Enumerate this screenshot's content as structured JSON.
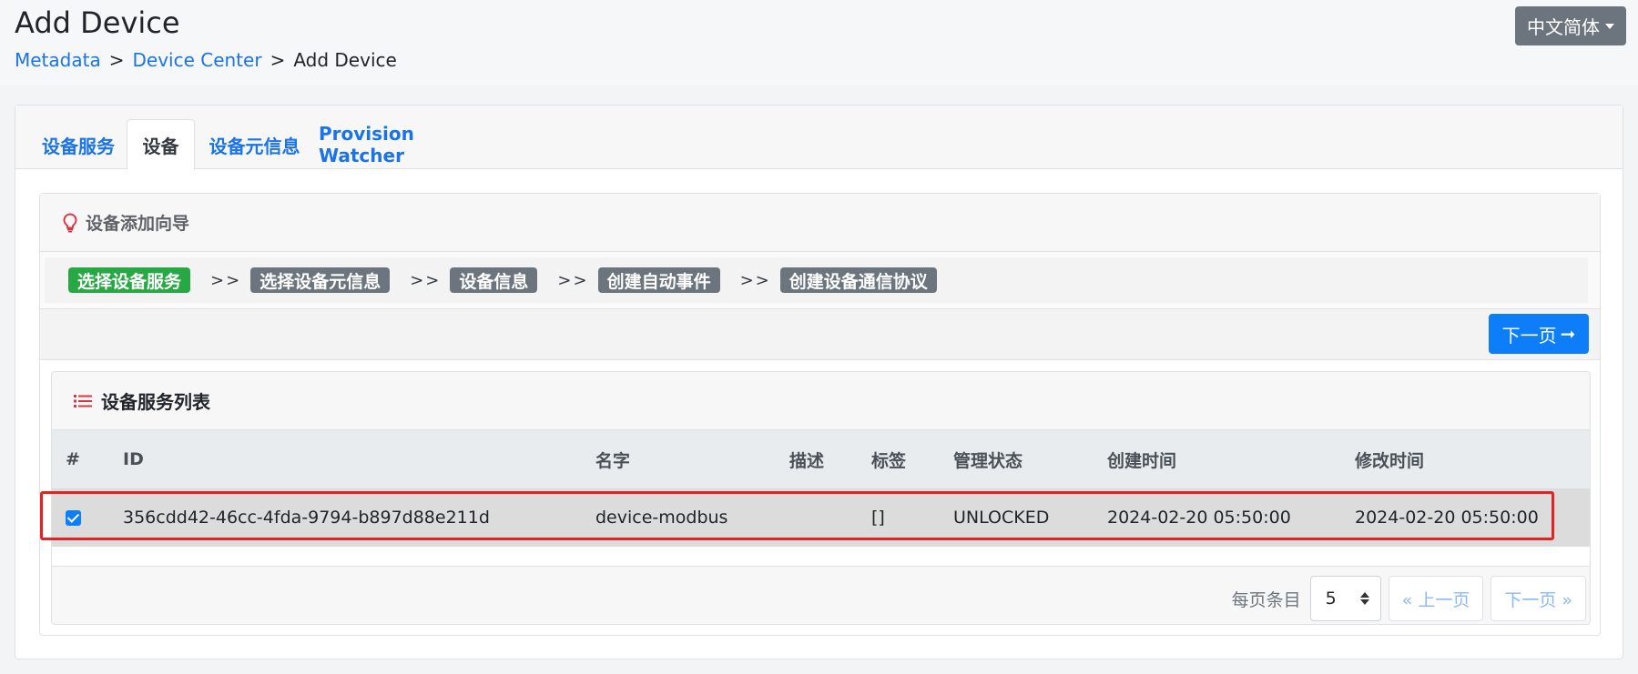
{
  "header": {
    "title": "Add Device",
    "breadcrumb": {
      "item1": "Metadata",
      "sep1": ">",
      "item2": "Device Center",
      "sep2": ">",
      "current": "Add Device"
    },
    "language_button": "中文简体"
  },
  "tabs": [
    {
      "label": "设备服务"
    },
    {
      "label": "设备"
    },
    {
      "label": "设备元信息"
    },
    {
      "label": "Provision Watcher"
    }
  ],
  "wizard": {
    "title": "设备添加向导",
    "steps": [
      {
        "label": "选择设备服务",
        "active": true
      },
      {
        "label": "选择设备元信息",
        "active": false
      },
      {
        "label": "设备信息",
        "active": false
      },
      {
        "label": "创建自动事件",
        "active": false
      },
      {
        "label": "创建设备通信协议",
        "active": false
      }
    ],
    "step_separator": ">>",
    "next_button": "下一页",
    "next_arrow": "➞"
  },
  "service_list": {
    "title": "设备服务列表",
    "columns": [
      "#",
      "ID",
      "名字",
      "描述",
      "标签",
      "管理状态",
      "创建时间",
      "修改时间"
    ],
    "rows": [
      {
        "checked": true,
        "id": "356cdd42-46cc-4fda-9794-b897d88e211d",
        "name": "device-modbus",
        "description": "",
        "labels": "[]",
        "admin_state": "UNLOCKED",
        "created": "2024-02-20 05:50:00",
        "modified": "2024-02-20 05:50:00"
      }
    ]
  },
  "pagination": {
    "per_page_label": "每页条目",
    "per_page_value": "5",
    "prev_label": "« 上一页",
    "next_label": "下一页 »"
  },
  "colors": {
    "accent": "#0d7ef8",
    "active_step": "#28a745",
    "inactive_step": "#6c757d",
    "highlight": "#e32222"
  }
}
